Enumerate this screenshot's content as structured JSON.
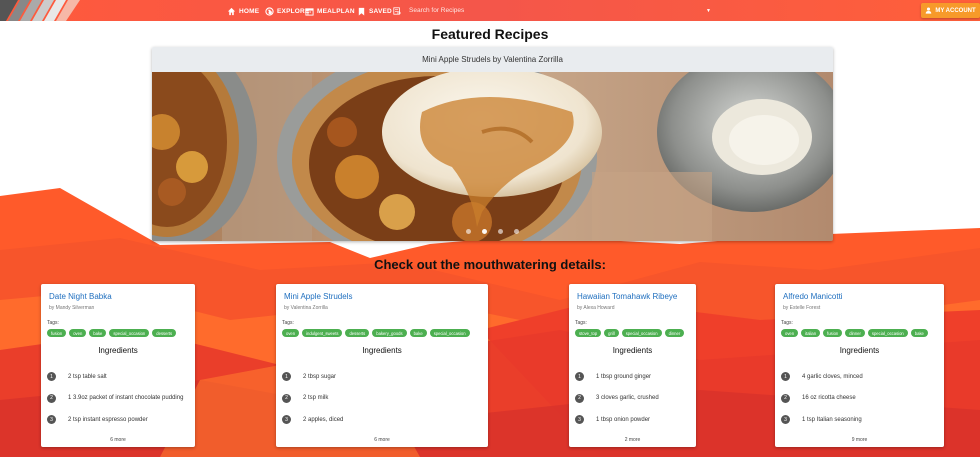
{
  "colors": {
    "nav_bg": "#f4564a",
    "accent_orange": "#f79a2a",
    "link_blue": "#1f6fbf",
    "tag_green": "#4caf50",
    "bg_red": "#e83a2a"
  },
  "nav": {
    "items": [
      {
        "label": "HOME",
        "icon": "home-icon"
      },
      {
        "label": "EXPLORE",
        "icon": "globe-icon"
      },
      {
        "label": "MEALPLAN",
        "icon": "mealplan-icon"
      },
      {
        "label": "SAVED",
        "icon": "bookmark-icon"
      }
    ],
    "search_placeholder": "Search for Recipes",
    "account_label": "MY ACCOUNT"
  },
  "featured": {
    "title": "Featured Recipes",
    "caption": "Mini Apple Strudels by Valentina Zorrilla",
    "dots": 4,
    "active_dot": 1
  },
  "details_title": "Check out the mouthwatering details:",
  "cards": [
    {
      "title": "Date Night Babka",
      "author": "by Mandy Silverman",
      "tags_label": "Tags:",
      "tags": [
        "fusion",
        "oven",
        "bake",
        "special_occasion",
        "desserts"
      ],
      "ingredients_title": "Ingredients",
      "ingredients": [
        "2 tsp table salt",
        "1 3.9oz packet of instant chocolate pudding",
        "2 tsp instant espresso powder"
      ],
      "more": "6 more"
    },
    {
      "title": "Mini Apple Strudels",
      "author": "by Valentina Zorrilla",
      "tags_label": "Tags:",
      "tags": [
        "oven",
        "indulgent_sweets",
        "desserts",
        "bakery_goods",
        "bake",
        "special_occasion"
      ],
      "ingredients_title": "Ingredients",
      "ingredients": [
        "2 tbsp sugar",
        "2 tsp milk",
        "2 apples, diced"
      ],
      "more": "6 more"
    },
    {
      "title": "Hawaiian Tomahawk Ribeye",
      "author": "by Alexa Howard",
      "tags_label": "Tags:",
      "tags": [
        "stove_top",
        "grill",
        "special_occasion",
        "dinner"
      ],
      "ingredients_title": "Ingredients",
      "ingredients": [
        "1 tbsp ground ginger",
        "3 cloves garlic, crushed",
        "1 tbsp onion powder"
      ],
      "more": "2 more"
    },
    {
      "title": "Alfredo Manicotti",
      "author": "by Estelle Forest",
      "tags_label": "Tags:",
      "tags": [
        "oven",
        "italian",
        "fusion",
        "dinner",
        "special_occasion",
        "bake"
      ],
      "ingredients_title": "Ingredients",
      "ingredients": [
        "4 garlic cloves, minced",
        "16 oz ricotta cheese",
        "1 tsp Italian seasoning"
      ],
      "more": "9 more"
    }
  ]
}
